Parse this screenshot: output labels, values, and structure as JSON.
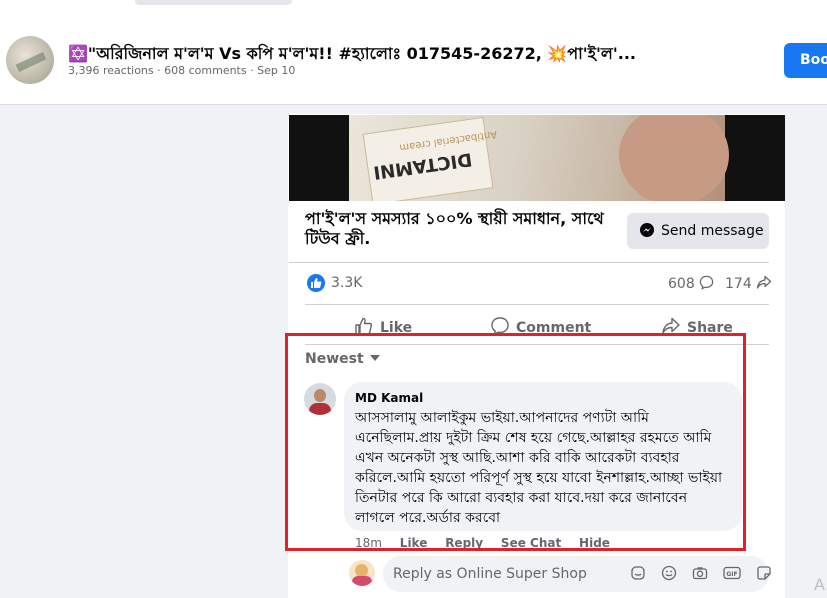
{
  "post_header": {
    "title_prefix": "✡️",
    "title": "\"অরিজিনাল ম'ল'ম Vs কপি ম'ল'ম!! #হ্যালোঃ 017545-26272, 💥পা'ই'ল'...",
    "meta": "3,396 reactions · 608 comments · Sep 10",
    "book_button": "Boo"
  },
  "ad": {
    "media_brand": "DICTAMNI",
    "media_subtitle": "Antibacterial cream",
    "headline": "পা'ই'ল'স সমস্যার ১০০% স্থায়ী সমাধান, সাথে টিউব ফ্রী.",
    "send_message_label": "Send message"
  },
  "stats": {
    "reactions": "3.3K",
    "comments": "608",
    "shares": "174"
  },
  "actions": {
    "like": "Like",
    "comment": "Comment",
    "share": "Share"
  },
  "comments_section": {
    "sort_label": "Newest",
    "comment": {
      "author": "MD Kamal",
      "text": "আসসালামু আলাইকুম ভাইয়া.আপনাদের পণ্যটা আমি এনেছিলাম.প্রায় দুইটা ক্রিম শেষ হয়ে গেছে.আল্লাহর রহমতে আমি এখন অনেকটা সুস্থ আছি.আশা করি বাকি আরেকটা ব্যবহার করিলে.আমি হয়তো পরিপূর্ণ সুস্থ হয়ে যাবো ইনশাল্লাহ.আচ্ছা ভাইয়া তিনটার পরে কি আরো ব্যবহার করা যাবে.দয়া করে জানাবেন লাগলে পরে.অর্ডার করবো",
      "time": "18m",
      "like": "Like",
      "reply": "Reply",
      "see_chat": "See Chat",
      "hide": "Hide"
    },
    "reply_placeholder": "Reply as Online Super Shop"
  },
  "icons": [
    "messenger-icon",
    "like-icon",
    "comment-icon",
    "share-icon",
    "emoji-icon",
    "camera-icon",
    "gif-icon",
    "sticker-icon"
  ],
  "colors": {
    "accent": "#1877f2",
    "highlight_border": "#e0202a",
    "background": "#f0f2f5"
  },
  "corner_letter": "A"
}
